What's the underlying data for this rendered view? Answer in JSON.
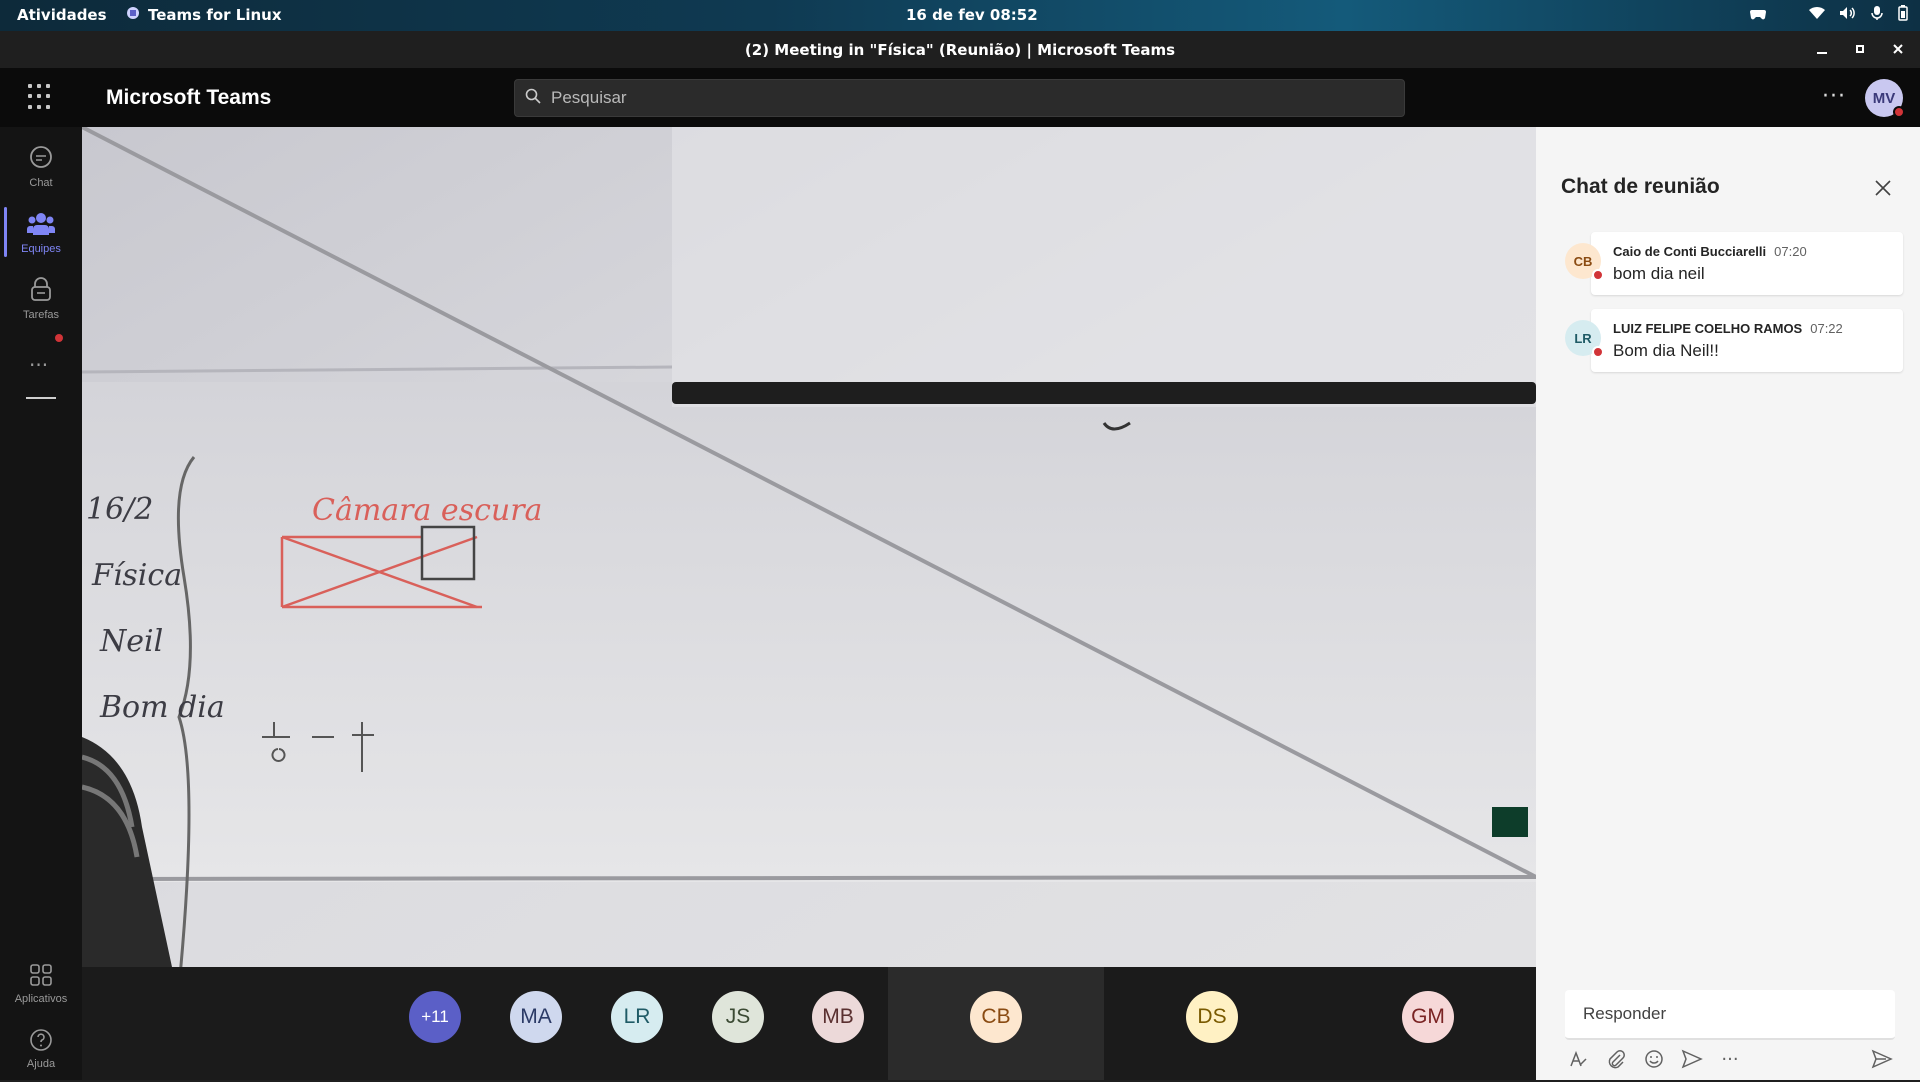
{
  "topbar": {
    "activities": "Atividades",
    "app_name": "Teams for Linux",
    "clock": "16 de fev  08:52"
  },
  "window": {
    "title": "(2) Meeting in \"Física\" (Reunião) | Microsoft Teams"
  },
  "header": {
    "brand": "Microsoft Teams",
    "search_placeholder": "Pesquisar",
    "user_initials": "MV"
  },
  "rail": {
    "items": [
      {
        "label": "Chat",
        "icon": "chat-icon"
      },
      {
        "label": "Equipes",
        "icon": "teams-icon",
        "active": true
      },
      {
        "label": "Tarefas",
        "icon": "tasks-icon"
      }
    ],
    "apps_label": "Aplicativos",
    "help_label": "Ajuda"
  },
  "whiteboard": {
    "left_column": [
      "16/2",
      "Física",
      "Neil",
      "Bom dia"
    ],
    "title": "Câmara escura"
  },
  "participants": [
    {
      "initials": "+11",
      "bg": "#5b5fc7",
      "fg": "#ffffff"
    },
    {
      "initials": "MA",
      "bg": "#cfd8ee",
      "fg": "#2b3a66"
    },
    {
      "initials": "LR",
      "bg": "#d6ecf0",
      "fg": "#1f5b66"
    },
    {
      "initials": "JS",
      "bg": "#dfe5da",
      "fg": "#3b4a33"
    },
    {
      "initials": "MB",
      "bg": "#ecd9d9",
      "fg": "#5a3030"
    },
    {
      "initials": "CB",
      "bg": "#fde7cf",
      "fg": "#8a4b12"
    },
    {
      "initials": "DS",
      "bg": "#fff1c4",
      "fg": "#7a5a00"
    },
    {
      "initials": "GM",
      "bg": "#f6d8d8",
      "fg": "#7a2323"
    }
  ],
  "chat": {
    "title": "Chat de reunião",
    "messages": [
      {
        "initials": "CB",
        "author": "Caio de Conti Bucciarelli",
        "time": "07:20",
        "text": "bom dia neil",
        "avatar_bg": "#fde7cf",
        "avatar_fg": "#8a4b12"
      },
      {
        "initials": "LR",
        "author": "LUIZ FELIPE COELHO RAMOS",
        "time": "07:22",
        "text": "Bom dia Neil!!",
        "avatar_bg": "#d6ecf0",
        "avatar_fg": "#1f5b66"
      }
    ],
    "reply_placeholder": "Responder"
  },
  "colors": {
    "accent": "#7f85f5",
    "presence_busy": "#d13438"
  }
}
